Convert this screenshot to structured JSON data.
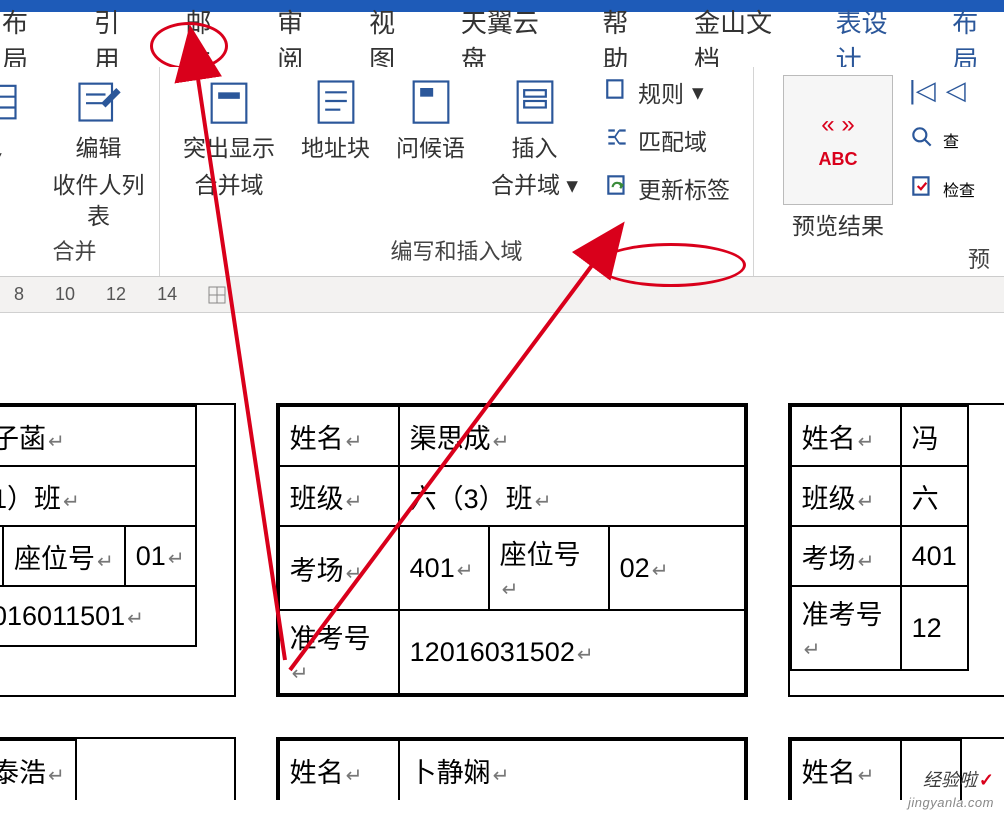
{
  "tabs": {
    "layout1": "布局",
    "references": "引用",
    "mailings": "邮件",
    "review": "审阅",
    "view": "视图",
    "tianyi": "天翼云盘",
    "help": "帮助",
    "jinshan": "金山文档",
    "table_design": "表设计",
    "layout2": "布局"
  },
  "ribbon": {
    "edit_recipients": {
      "line1": "编辑",
      "line2": "收件人列表"
    },
    "highlight_merge": {
      "line1": "突出显示",
      "line2": "合并域"
    },
    "address_block": "地址块",
    "greeting": "问候语",
    "insert_merge": {
      "line1": "插入",
      "line2": "合并域"
    },
    "rules": "规则",
    "match_fields": "匹配域",
    "update_labels": "更新标签",
    "preview_results": "预览结果",
    "abc": "ABC",
    "find_recipient": "查",
    "check_errors": "检查",
    "group_mail_merge_partial": "合并",
    "group_write_insert": "编写和插入域",
    "group_preview_partial": "预"
  },
  "ruler": {
    "m8": "8",
    "m10": "10",
    "m12": "12",
    "m14": "14"
  },
  "label_left": {
    "name_val": "子菡",
    "class_val": "1）班",
    "seat_label": "座位号",
    "seat_val": "01",
    "exam_id_val": "016011501",
    "row2_name_val": "泰浩"
  },
  "label_mid": {
    "name_key": "姓名",
    "name_val": "渠思成",
    "class_key": "班级",
    "class_val": "六（3）班",
    "room_key": "考场",
    "room_val": "401",
    "seat_key": "座位号",
    "seat_val": "02",
    "exam_key": "准考号",
    "exam_val": "12016031502",
    "row2_name_key": "姓名",
    "row2_name_val": "卜静娴"
  },
  "label_right": {
    "name_key": "姓名",
    "name_val": "冯",
    "class_key": "班级",
    "class_val": "六",
    "room_key": "考场",
    "room_val": "401",
    "exam_key": "准考号",
    "exam_val": "12",
    "row2_name_key": "姓名"
  },
  "watermark": {
    "text": "经验啦",
    "sub": "jingyanla.com"
  }
}
